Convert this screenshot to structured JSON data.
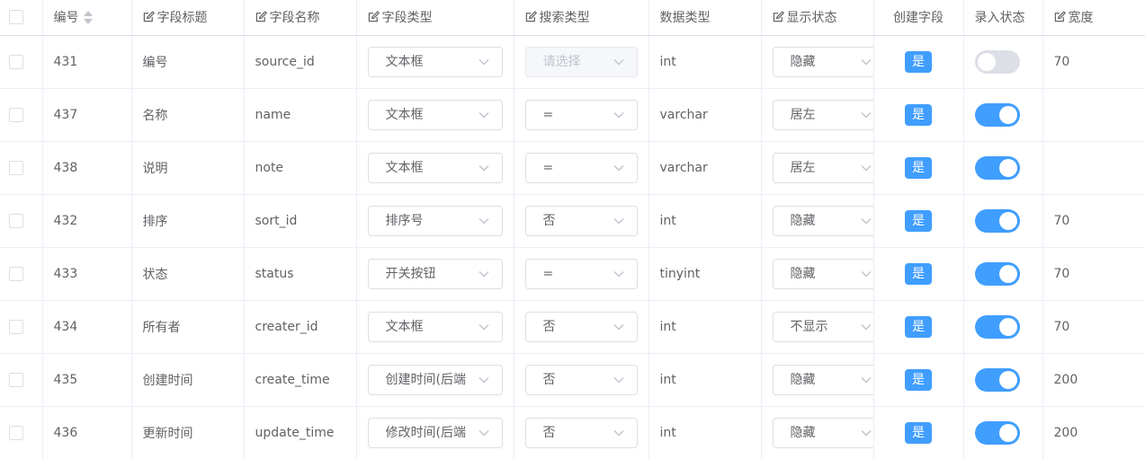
{
  "headers": {
    "id": "编号",
    "title": "字段标题",
    "name": "字段名称",
    "field_type": "字段类型",
    "search_type": "搜索类型",
    "data_type": "数据类型",
    "display": "显示状态",
    "create": "创建字段",
    "input": "录入状态",
    "width": "宽度"
  },
  "icons": {
    "edit": "edit-icon",
    "sort": "sort-caret-icon",
    "dropdown": "chevron-down-icon"
  },
  "colors": {
    "primary": "#409eff",
    "switch_off": "#dcdfe6",
    "border": "#ebeef5"
  },
  "rows": [
    {
      "id": "431",
      "title": "编号",
      "name": "source_id",
      "field_type": "文本框",
      "search_type": "请选择",
      "search_placeholder": true,
      "data_type": "int",
      "display": "隐藏",
      "create": "是",
      "input_on": false,
      "width": "70"
    },
    {
      "id": "437",
      "title": "名称",
      "name": "name",
      "field_type": "文本框",
      "search_type": "=",
      "search_placeholder": false,
      "data_type": "varchar",
      "display": "居左",
      "create": "是",
      "input_on": true,
      "width": ""
    },
    {
      "id": "438",
      "title": "说明",
      "name": "note",
      "field_type": "文本框",
      "search_type": "=",
      "search_placeholder": false,
      "data_type": "varchar",
      "display": "居左",
      "create": "是",
      "input_on": true,
      "width": ""
    },
    {
      "id": "432",
      "title": "排序",
      "name": "sort_id",
      "field_type": "排序号",
      "search_type": "否",
      "search_placeholder": false,
      "data_type": "int",
      "display": "隐藏",
      "create": "是",
      "input_on": true,
      "width": "70"
    },
    {
      "id": "433",
      "title": "状态",
      "name": "status",
      "field_type": "开关按钮",
      "search_type": "=",
      "search_placeholder": false,
      "data_type": "tinyint",
      "display": "隐藏",
      "create": "是",
      "input_on": true,
      "width": "70"
    },
    {
      "id": "434",
      "title": "所有者",
      "name": "creater_id",
      "field_type": "文本框",
      "search_type": "否",
      "search_placeholder": false,
      "data_type": "int",
      "display": "不显示",
      "create": "是",
      "input_on": true,
      "width": "70"
    },
    {
      "id": "435",
      "title": "创建时间",
      "name": "create_time",
      "field_type": "创建时间(后端",
      "search_type": "否",
      "search_placeholder": false,
      "data_type": "int",
      "display": "隐藏",
      "create": "是",
      "input_on": true,
      "width": "200"
    },
    {
      "id": "436",
      "title": "更新时间",
      "name": "update_time",
      "field_type": "修改时间(后端",
      "search_type": "否",
      "search_placeholder": false,
      "data_type": "int",
      "display": "隐藏",
      "create": "是",
      "input_on": true,
      "width": "200"
    }
  ]
}
